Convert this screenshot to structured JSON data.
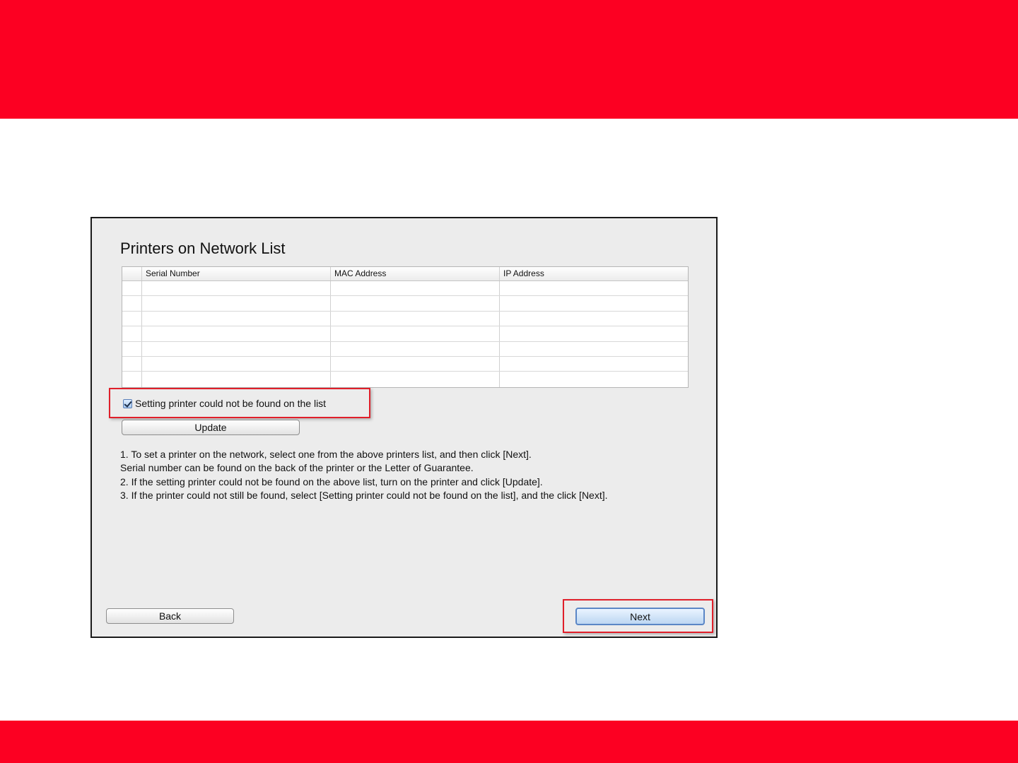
{
  "dialog": {
    "title": "Printers on Network List",
    "table": {
      "columns": [
        "",
        "Serial Number",
        "MAC Address",
        "IP Address"
      ],
      "rows": [
        [
          "",
          "",
          "",
          ""
        ],
        [
          "",
          "",
          "",
          ""
        ],
        [
          "",
          "",
          "",
          ""
        ],
        [
          "",
          "",
          "",
          ""
        ],
        [
          "",
          "",
          "",
          ""
        ],
        [
          "",
          "",
          "",
          ""
        ],
        [
          "",
          "",
          "",
          ""
        ]
      ]
    },
    "checkbox": {
      "label": "Setting printer could not be found on the list",
      "checked": true
    },
    "update_label": "Update",
    "instructions": [
      "1. To set a printer on the network, select one from the above printers list, and then click [Next].",
      "Serial number can be found on the back of the printer or the Letter of Guarantee.",
      "2. If the setting printer could not be found on the above list, turn on the printer and click [Update].",
      "3. If the printer could not still be found, select [Setting printer could not be found on the list], and the click [Next]."
    ],
    "back_label": "Back",
    "next_label": "Next"
  },
  "colors": {
    "brand_red": "#fc0022",
    "highlight_red": "#e01f2a",
    "dialog_bg": "#ececec",
    "default_button_blue": "#5a86c6"
  }
}
